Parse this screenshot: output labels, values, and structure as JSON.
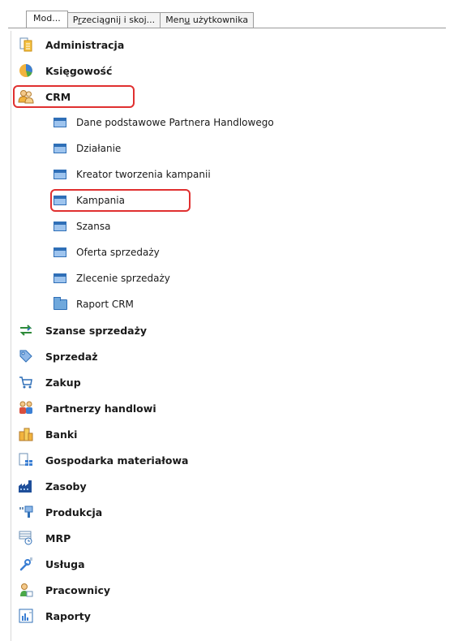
{
  "tabs": [
    {
      "label": "Mod...",
      "underline_index": -1
    },
    {
      "label": "Przeciągnij i skoj...",
      "underline_index": 1
    },
    {
      "label": "Menu użytkownika",
      "underline_index": 3
    }
  ],
  "modules": [
    {
      "label": "Administracja",
      "icon": "document-icon"
    },
    {
      "label": "Księgowość",
      "icon": "pie-chart-icon"
    },
    {
      "label": "CRM",
      "icon": "users-icon",
      "highlighted": true,
      "children": [
        {
          "label": "Dane podstawowe Partnera Handlowego",
          "icon": "window-icon"
        },
        {
          "label": "Działanie",
          "icon": "window-icon"
        },
        {
          "label": "Kreator tworzenia kampanii",
          "icon": "window-icon"
        },
        {
          "label": "Kampania",
          "icon": "window-icon",
          "highlighted": true
        },
        {
          "label": "Szansa",
          "icon": "window-icon"
        },
        {
          "label": "Oferta sprzedaży",
          "icon": "window-icon"
        },
        {
          "label": "Zlecenie sprzedaży",
          "icon": "window-icon"
        },
        {
          "label": "Raport CRM",
          "icon": "folder-icon"
        }
      ]
    },
    {
      "label": "Szanse sprzedaży",
      "icon": "arrows-icon"
    },
    {
      "label": "Sprzedaż",
      "icon": "tag-icon"
    },
    {
      "label": "Zakup",
      "icon": "cart-icon"
    },
    {
      "label": "Partnerzy handlowi",
      "icon": "partners-icon"
    },
    {
      "label": "Banki",
      "icon": "bank-icon"
    },
    {
      "label": "Gospodarka materiałowa",
      "icon": "inventory-icon"
    },
    {
      "label": "Zasoby",
      "icon": "factory-icon"
    },
    {
      "label": "Produkcja",
      "icon": "production-icon"
    },
    {
      "label": "MRP",
      "icon": "mrp-icon"
    },
    {
      "label": "Usługa",
      "icon": "wrench-icon"
    },
    {
      "label": "Pracownicy",
      "icon": "employee-icon"
    },
    {
      "label": "Raporty",
      "icon": "report-icon"
    }
  ],
  "colors": {
    "highlight": "#e03030",
    "icon_blue": "#2f6fb7"
  }
}
